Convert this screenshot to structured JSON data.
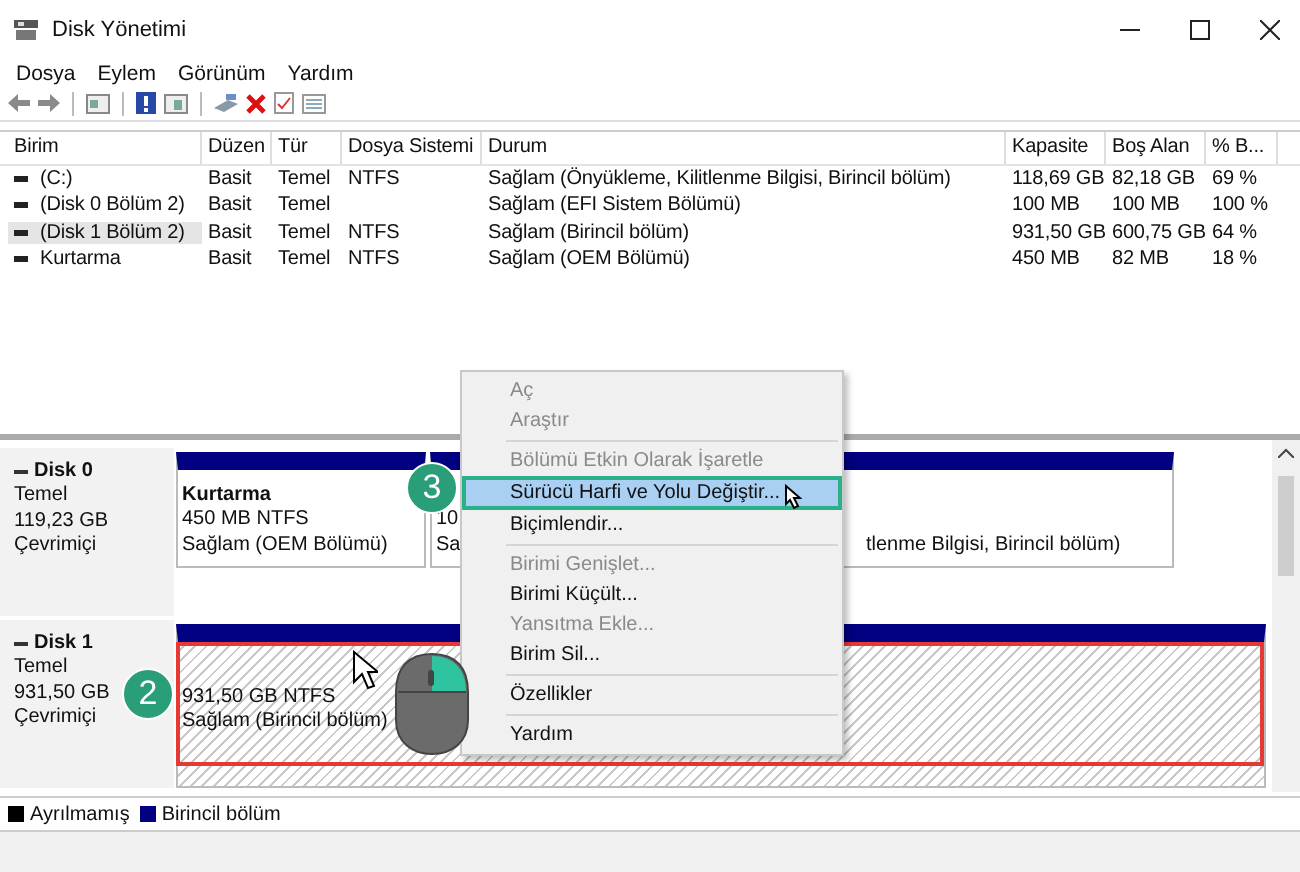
{
  "window": {
    "title": "Disk Yönetimi"
  },
  "menu": [
    "Dosya",
    "Eylem",
    "Görünüm",
    "Yardım"
  ],
  "volumes": {
    "columns": [
      "Birim",
      "Düzen",
      "Tür",
      "Dosya Sistemi",
      "Durum",
      "Kapasite",
      "Boş Alan",
      "% B..."
    ],
    "rows": [
      {
        "cells": [
          "(C:)",
          "Basit",
          "Temel",
          "NTFS",
          "Sağlam (Önyükleme, Kilitlenme Bilgisi, Birincil bölüm)",
          "118,69 GB",
          "82,18 GB",
          "69 %"
        ],
        "selected": false
      },
      {
        "cells": [
          "(Disk 0 Bölüm 2)",
          "Basit",
          "Temel",
          "",
          "Sağlam (EFI Sistem Bölümü)",
          "100 MB",
          "100 MB",
          "100 %"
        ],
        "selected": false
      },
      {
        "cells": [
          "(Disk 1 Bölüm 2)",
          "Basit",
          "Temel",
          "NTFS",
          "Sağlam (Birincil bölüm)",
          "931,50 GB",
          "600,75 GB",
          "64 %"
        ],
        "selected": true
      },
      {
        "cells": [
          "Kurtarma",
          "Basit",
          "Temel",
          "NTFS",
          "Sağlam (OEM Bölümü)",
          "450 MB",
          "82 MB",
          "18 %"
        ],
        "selected": false
      }
    ]
  },
  "disks": [
    {
      "name": "Disk 0",
      "type": "Temel",
      "size": "119,23 GB",
      "status": "Çevrimiçi",
      "partitions": [
        {
          "name": "Kurtarma",
          "detail": "450 MB NTFS",
          "status": "Sağlam (OEM Bölümü)",
          "selected": false
        },
        {
          "detail": "10",
          "status": "Sa",
          "selected": false
        },
        {
          "status": "tlenme Bilgisi, Birincil bölüm)",
          "selected": false
        }
      ]
    },
    {
      "name": "Disk 1",
      "type": "Temel",
      "size": "931,50 GB",
      "status": "Çevrimiçi",
      "partitions": [
        {
          "detail": "931,50 GB NTFS",
          "status": "Sağlam (Birincil bölüm)",
          "selected": true
        }
      ]
    }
  ],
  "legend": [
    {
      "label": "Ayrılmamış",
      "color": "#000000"
    },
    {
      "label": "Birincil bölüm",
      "color": "#000080"
    }
  ],
  "context_menu": {
    "groups": [
      [
        {
          "label": "Aç",
          "disabled": true,
          "selected": false
        },
        {
          "label": "Araştır",
          "disabled": true,
          "selected": false
        }
      ],
      [
        {
          "label": "Bölümü Etkin Olarak İşaretle",
          "disabled": true,
          "selected": false
        },
        {
          "label": "Sürücü Harfi ve Yolu Değiştir...",
          "disabled": false,
          "selected": true
        },
        {
          "label": "Biçimlendir...",
          "disabled": false,
          "selected": false
        }
      ],
      [
        {
          "label": "Birimi Genişlet...",
          "disabled": true,
          "selected": false
        },
        {
          "label": "Birimi Küçült...",
          "disabled": false,
          "selected": false
        },
        {
          "label": "Yansıtma Ekle...",
          "disabled": true,
          "selected": false
        },
        {
          "label": "Birim Sil...",
          "disabled": false,
          "selected": false
        }
      ],
      [
        {
          "label": "Özellikler",
          "disabled": false,
          "selected": false
        }
      ],
      [
        {
          "label": "Yardım",
          "disabled": false,
          "selected": false
        }
      ]
    ]
  },
  "annotations": [
    {
      "label": "2"
    },
    {
      "label": "3"
    }
  ]
}
